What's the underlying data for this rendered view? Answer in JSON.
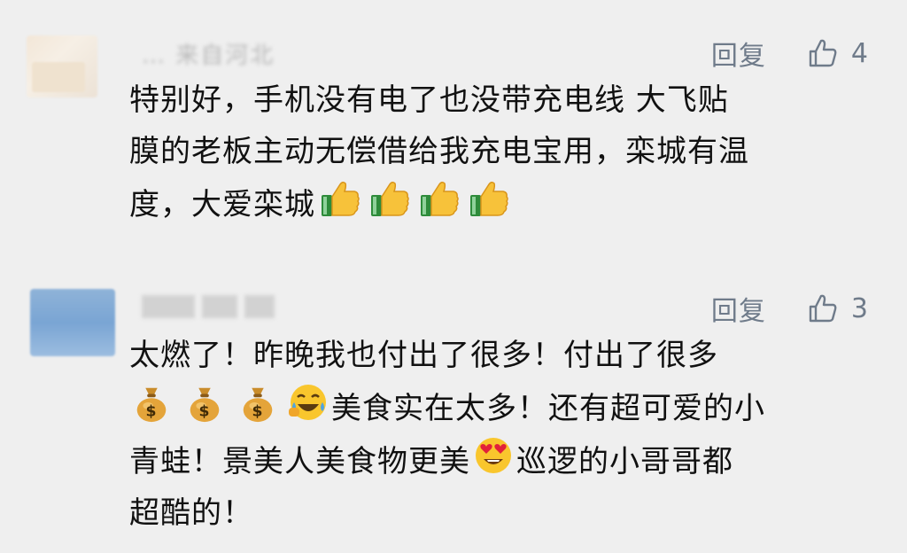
{
  "comments": [
    {
      "username": "… 来自河北",
      "reply_label": "回复",
      "like_count": "4",
      "text_lines": [
        "特别好，手机没有电了也没带充电线 大飞贴",
        "膜的老板主动无偿借给我充电宝用，栾城有温",
        "度，大爱栾城"
      ],
      "emojis": [
        "thumbs-up",
        "thumbs-up",
        "thumbs-up",
        "thumbs-up"
      ]
    },
    {
      "username": "",
      "reply_label": "回复",
      "like_count": "3",
      "text_lines": [
        "太燃了！昨晚我也付出了很多！付出了很多",
        "美食实在太多！还有超可爱的小",
        "青蛙！景美人美食物更美",
        "巡逻的小哥哥都",
        "超酷的！"
      ],
      "emojis": [
        "money-bag",
        "money-bag",
        "money-bag",
        "laughing-crying",
        "heart-eyes"
      ]
    }
  ],
  "colors": {
    "background": "#efefef",
    "action_text": "#6f7b8a",
    "body_text": "#111111"
  }
}
